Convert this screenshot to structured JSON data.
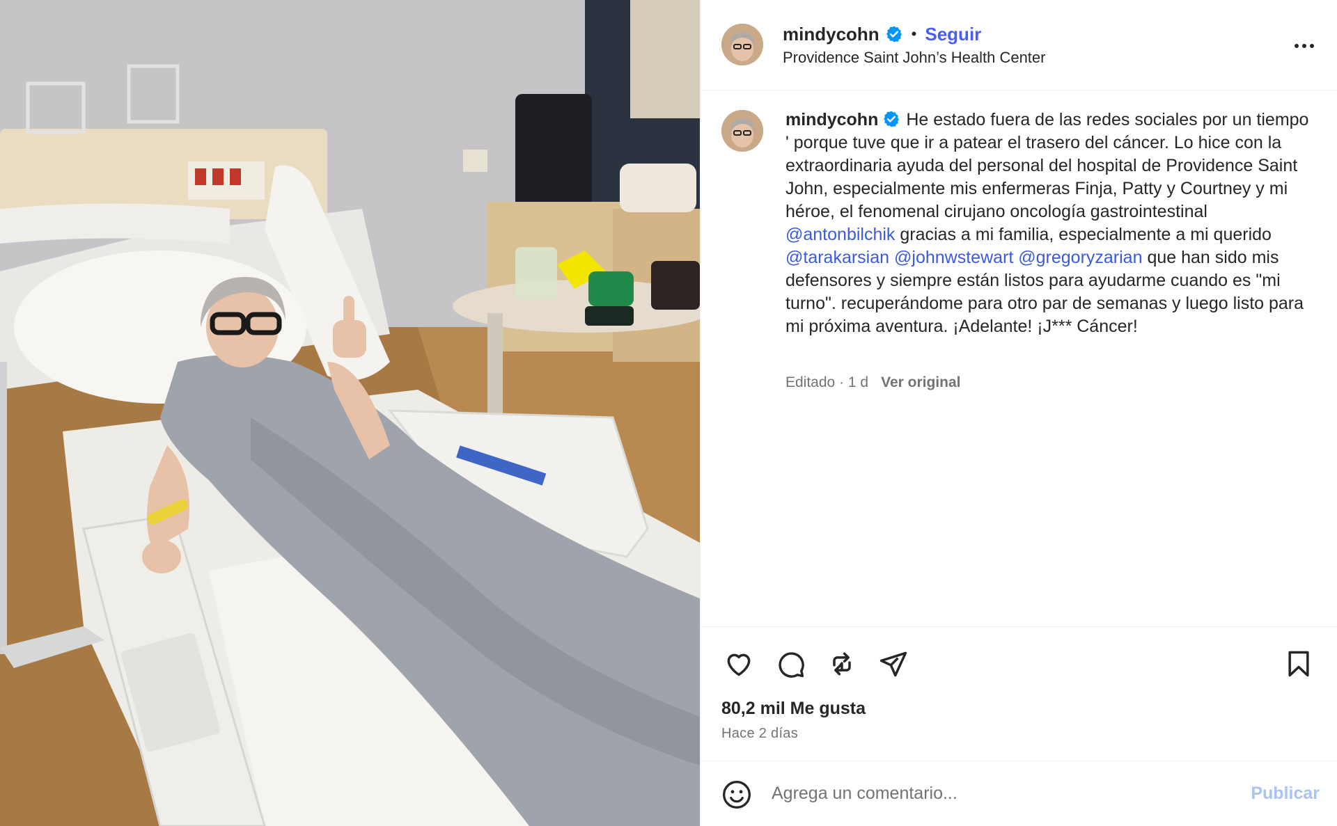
{
  "post": {
    "username": "mindycohn",
    "follow_label": "Seguir",
    "separator": "•",
    "location": "Providence Saint John’s Health Center",
    "caption": {
      "text_parts": {
        "p1": "He estado fuera de las redes sociales por un tiempo ' porque tuve que ir a patear el trasero del cáncer. Lo hice con la extraordinaria ayuda del personal del hospital de Providence Saint John, especialmente mis enfermeras Finja, Patty y Courtney y mi héroe, el fenomenal cirujano oncología gastrointestinal ",
        "m1": "@antonbilchik",
        "p2": " gracias a mi familia, especialmente a mi querido ",
        "m2": "@tarakarsian",
        "p3": " ",
        "m3": "@johnwstewart",
        "p4": " ",
        "m4": "@gregoryzarian",
        "p5": " que han sido mis defensores y siempre están listos para ayudarme cuando es \"mi turno\". recuperándome para otro par de semanas y luego listo para mi próxima aventura. ¡Adelante! ¡J*** Cáncer!"
      },
      "edited": "Editado · 1 d",
      "see_original": "Ver original"
    },
    "likes": "80,2 mil Me gusta",
    "posted_ago": "Hace 2 días",
    "comment": {
      "placeholder": "Agrega un comentario...",
      "publish_label": "Publicar"
    },
    "icons": [
      "heart-icon",
      "comment-icon",
      "repost-icon",
      "share-icon",
      "bookmark-icon",
      "emoji-icon",
      "more-icon",
      "verified-icon"
    ],
    "colors": {
      "link": "#4a5df9",
      "mention": "#3b5bdb",
      "verified": "#0095f6",
      "muted": "#737373",
      "publish_disabled": "#a9c3f7"
    }
  }
}
